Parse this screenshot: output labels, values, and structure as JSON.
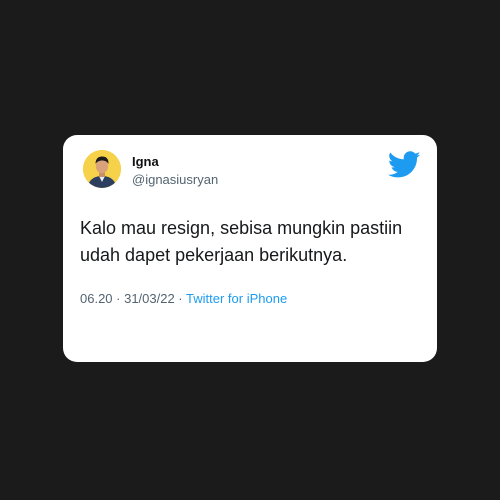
{
  "tweet": {
    "author_name": "Igna",
    "author_handle": "@ignasiusryan",
    "text": "Kalo mau resign, sebisa mungkin pastiin udah dapet pekerjaan berikutnya.",
    "timestamp": "06.20 · 31/03/22 ·",
    "source": "Twitter for iPhone"
  },
  "icons": {
    "avatar": "profile-photo",
    "logo": "twitter-bird-icon"
  },
  "colors": {
    "background": "#1c1b1c",
    "card": "#ffffff",
    "accent": "#1d9bf0",
    "secondary_text": "#536471",
    "avatar_bg": "#f6d24a"
  }
}
